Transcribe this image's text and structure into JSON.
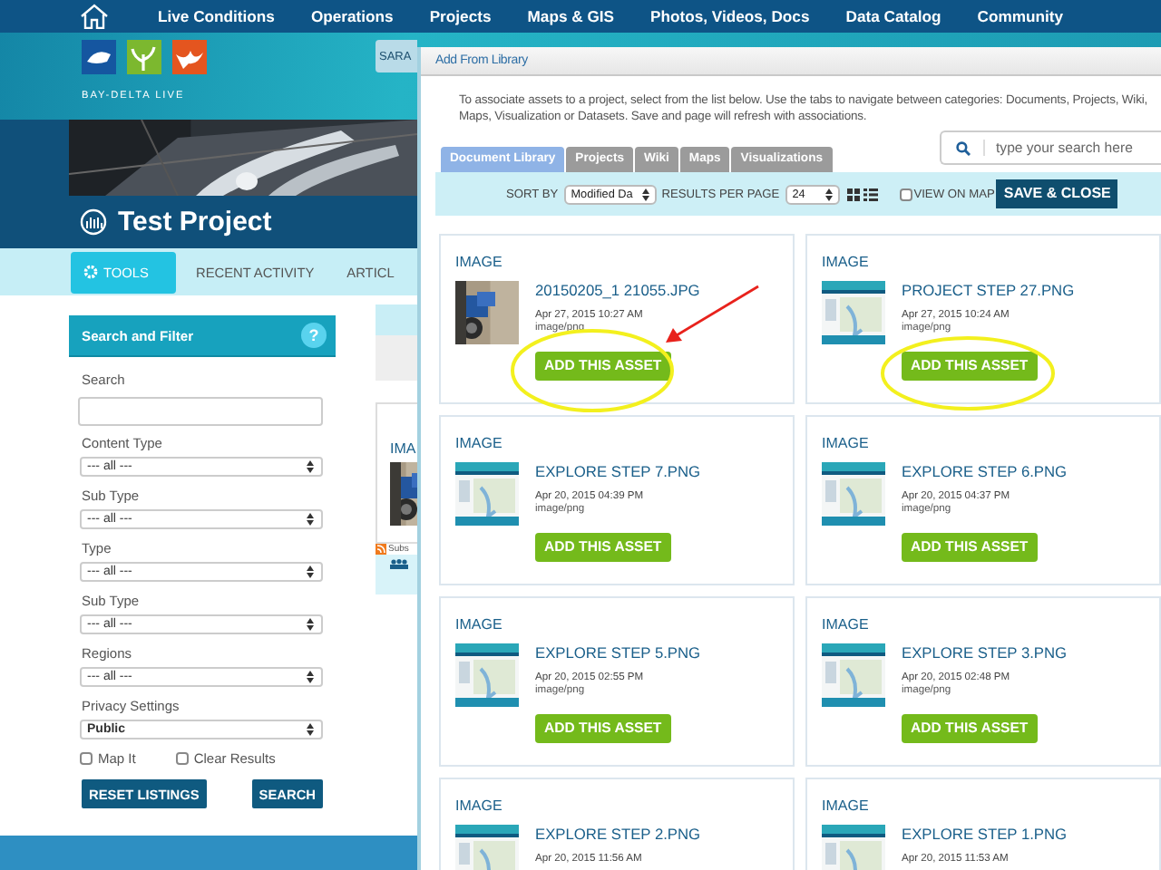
{
  "nav": {
    "items": [
      "Live Conditions",
      "Operations",
      "Projects",
      "Maps & GIS",
      "Photos, Videos, Docs",
      "Data Catalog",
      "Community"
    ]
  },
  "logo": {
    "text": "BAY-DELTA LIVE"
  },
  "banner": {
    "user_tab": "SARA"
  },
  "project": {
    "title": "Test Project"
  },
  "tabs": [
    {
      "label": "TOOLS",
      "selected": true
    },
    {
      "label": "RECENT ACTIVITY",
      "selected": false
    },
    {
      "label": "ARTICL",
      "selected": false
    }
  ],
  "filter": {
    "title": "Search and Filter",
    "help": "?",
    "search_label": "Search",
    "selects": [
      {
        "label": "Content Type",
        "value": "--- all ---"
      },
      {
        "label": "Sub Type",
        "value": "--- all ---"
      },
      {
        "label": "Type",
        "value": "--- all ---"
      },
      {
        "label": "Sub Type",
        "value": "--- all ---"
      },
      {
        "label": "Regions",
        "value": "--- all ---"
      },
      {
        "label": "Privacy Settings",
        "value": "Public"
      }
    ],
    "checkboxes": [
      {
        "label": "Map It",
        "checked": false
      },
      {
        "label": "Clear Results",
        "checked": false
      }
    ],
    "buttons": [
      "RESET LISTINGS",
      "SEARCH"
    ]
  },
  "behind_card": {
    "type": "IMA",
    "subscribe": "Subs"
  },
  "modal": {
    "title": "Add From Library",
    "intro": "To associate assets to a project, select from the list below. Use the tabs to navigate between categories: Documents, Projects, Wiki, Maps, Visualization or Datasets. Save and page will refresh with associations.",
    "tabs": [
      {
        "label": "Document Library",
        "selected": true
      },
      {
        "label": "Projects",
        "selected": false
      },
      {
        "label": "Wiki",
        "selected": false
      },
      {
        "label": "Maps",
        "selected": false
      },
      {
        "label": "Visualizations",
        "selected": false
      }
    ],
    "search": {
      "placeholder": "type your search here"
    },
    "toolbar": {
      "sort_label": "SORT BY",
      "sort_value": "Modified Da",
      "per_page_label": "RESULTS PER PAGE",
      "per_page_value": "24",
      "map_checkbox": {
        "label": "VIEW ON MAP",
        "checked": false
      },
      "save": "SAVE & CLOSE"
    },
    "assets": [
      {
        "type": "IMAGE",
        "name": "20150205_1 21055.JPG",
        "date": "Apr 27, 2015 10:27 AM",
        "mime": "image/png",
        "button": "ADD THIS ASSET",
        "highlighted": true,
        "arrow": true
      },
      {
        "type": "IMAGE",
        "name": "PROJECT STEP 27.PNG",
        "date": "Apr 27, 2015 10:24 AM",
        "mime": "image/png",
        "button": "ADD THIS ASSET",
        "highlighted": true,
        "arrow": false
      },
      {
        "type": "IMAGE",
        "name": "EXPLORE STEP 7.PNG",
        "date": "Apr 20, 2015 04:39 PM",
        "mime": "image/png",
        "button": "ADD THIS ASSET",
        "highlighted": false,
        "arrow": false
      },
      {
        "type": "IMAGE",
        "name": "EXPLORE STEP 6.PNG",
        "date": "Apr 20, 2015 04:37 PM",
        "mime": "image/png",
        "button": "ADD THIS ASSET",
        "highlighted": false,
        "arrow": false
      },
      {
        "type": "IMAGE",
        "name": "EXPLORE STEP 5.PNG",
        "date": "Apr 20, 2015 02:55 PM",
        "mime": "image/png",
        "button": "ADD THIS ASSET",
        "highlighted": false,
        "arrow": false
      },
      {
        "type": "IMAGE",
        "name": "EXPLORE STEP 3.PNG",
        "date": "Apr 20, 2015 02:48 PM",
        "mime": "image/png",
        "button": "ADD THIS ASSET",
        "highlighted": false,
        "arrow": false
      },
      {
        "type": "IMAGE",
        "name": "EXPLORE STEP 2.PNG",
        "date": "Apr 20, 2015 11:56 AM",
        "highlighted": false,
        "arrow": false
      },
      {
        "type": "IMAGE",
        "name": "EXPLORE STEP 1.PNG",
        "date": "Apr 20, 2015 11:53 AM",
        "highlighted": false,
        "arrow": false
      }
    ]
  }
}
